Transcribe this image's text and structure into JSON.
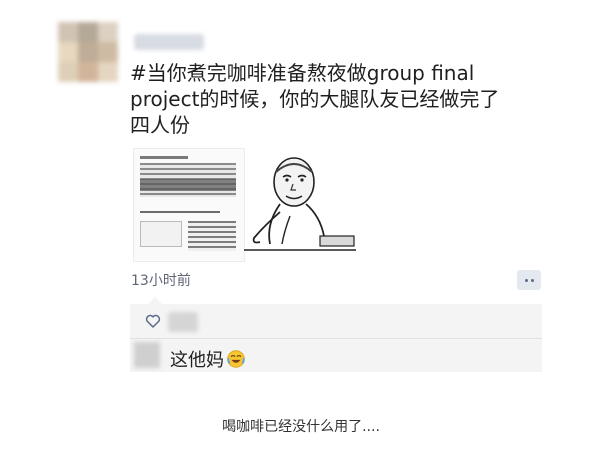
{
  "post": {
    "text": "#当你煮完咖啡准备熬夜做group final project的时候，你的大腿队友已经做完了四人份",
    "timestamp": "13小时前"
  },
  "comment": {
    "text": "这他妈"
  },
  "caption": "喝咖啡已经没什么用了....",
  "icons": {
    "like": "heart-outline-icon",
    "more": "more-dots-icon",
    "emoji": "crying-laughing-emoji-icon"
  },
  "colors": {
    "text": "#1f1f1f",
    "time": "#5f6675",
    "panel": "#f4f4f4",
    "more_button": "#e4e8ef",
    "more_dots": "#5c6b89"
  }
}
